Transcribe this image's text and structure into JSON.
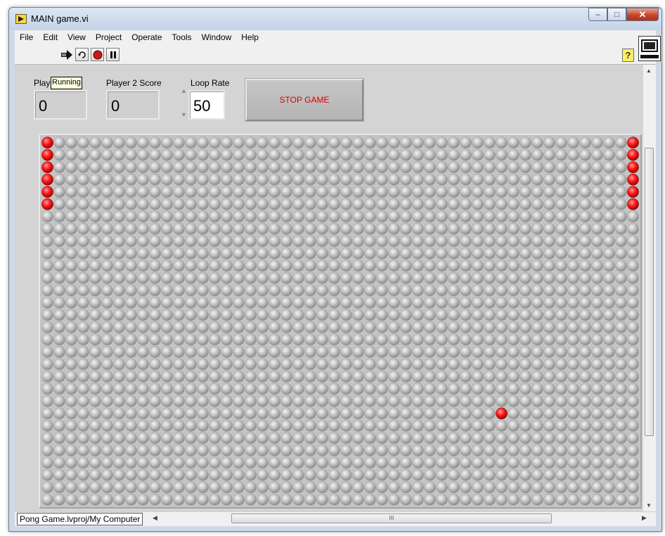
{
  "window": {
    "title": "MAIN game.vi",
    "controls": {
      "minimize": "–",
      "maximize": "□",
      "close": "✕"
    }
  },
  "menu": [
    "File",
    "Edit",
    "View",
    "Project",
    "Operate",
    "Tools",
    "Window",
    "Help"
  ],
  "toolbar": {
    "icons": [
      "run-arrow-icon",
      "run-continuously-icon",
      "abort-icon",
      "pause-icon"
    ],
    "tooltip": "Running",
    "help": "?"
  },
  "front_panel": {
    "player1": {
      "label": "Playe",
      "value": "0"
    },
    "player2": {
      "label": "Player 2 Score",
      "value": "0"
    },
    "loop_rate": {
      "label": "Loop Rate",
      "value": "50"
    },
    "stop_button": "STOP GAME",
    "led_grid": {
      "columns": 50,
      "rows": 30,
      "off_color": "#bdbdbd",
      "on_color": "#ff1a1a",
      "left_paddle": {
        "column": 0,
        "rows": [
          0,
          1,
          2,
          3,
          4,
          5
        ]
      },
      "right_paddle": {
        "column": 49,
        "rows": [
          0,
          1,
          2,
          3,
          4,
          5
        ]
      },
      "ball": {
        "column": 38,
        "row": 22
      }
    }
  },
  "statusbar": {
    "project_path": "Pong Game.lvproj/My Computer",
    "scroll_grip": "III"
  }
}
